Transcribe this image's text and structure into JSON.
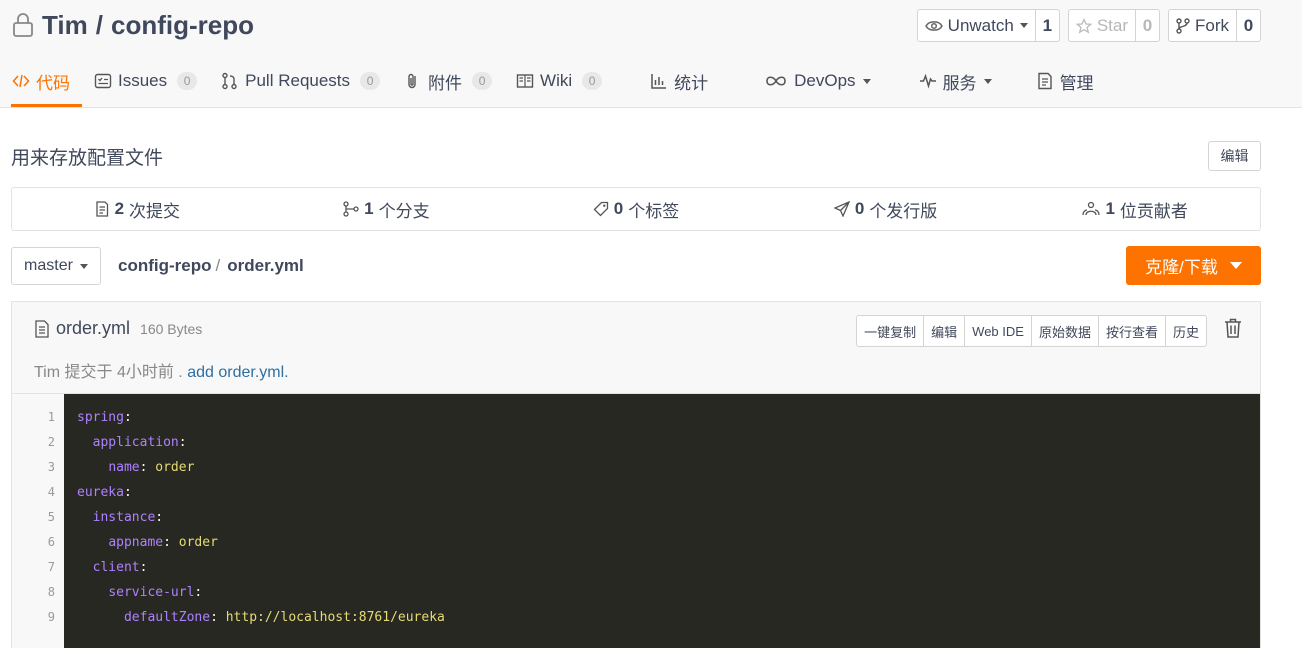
{
  "repo": {
    "owner": "Tim",
    "separator": "/",
    "name": "config-repo"
  },
  "actions": {
    "watch": {
      "label": "Unwatch",
      "count": "1"
    },
    "star": {
      "label": "Star",
      "count": "0"
    },
    "fork": {
      "label": "Fork",
      "count": "0"
    }
  },
  "tabs": [
    {
      "label": "代码",
      "icon": "code-icon",
      "active": true
    },
    {
      "label": "Issues",
      "icon": "issues-icon",
      "badge": "0"
    },
    {
      "label": "Pull Requests",
      "icon": "pull-request-icon",
      "badge": "0"
    },
    {
      "label": "附件",
      "icon": "paperclip-icon",
      "badge": "0"
    },
    {
      "label": "Wiki",
      "icon": "book-icon",
      "badge": "0"
    },
    {
      "label": "统计",
      "icon": "bar-chart-icon"
    },
    {
      "label": "DevOps",
      "icon": "infinity-icon",
      "dropdown": true
    },
    {
      "label": "服务",
      "icon": "pulse-icon",
      "dropdown": true
    },
    {
      "label": "管理",
      "icon": "manage-icon"
    }
  ],
  "description": "用来存放配置文件",
  "edit_label": "编辑",
  "stats": [
    {
      "count": "2",
      "label": "次提交",
      "icon": "commit-icon"
    },
    {
      "count": "1",
      "label": "个分支",
      "icon": "branch-icon"
    },
    {
      "count": "0",
      "label": "个标签",
      "icon": "tag-icon"
    },
    {
      "count": "0",
      "label": "个发行版",
      "icon": "release-icon"
    },
    {
      "count": "1",
      "label": "位贡献者",
      "icon": "contributors-icon"
    }
  ],
  "branch": "master",
  "breadcrumb": {
    "repo": "config-repo",
    "slash": "/",
    "file": "order.yml"
  },
  "clone_label": "克隆/下载",
  "file": {
    "name": "order.yml",
    "size": "160 Bytes",
    "commit_author": "Tim",
    "commit_text": "提交于 4小时前 .",
    "commit_message": "add order.yml.",
    "buttons": [
      "一键复制",
      "编辑",
      "Web IDE",
      "原始数据",
      "按行查看",
      "历史"
    ]
  },
  "code": {
    "line_numbers": [
      "1",
      "2",
      "3",
      "4",
      "5",
      "6",
      "7",
      "8",
      "9"
    ],
    "lines": [
      {
        "indent": "",
        "key": "spring",
        "value": ""
      },
      {
        "indent": "  ",
        "key": "application",
        "value": ""
      },
      {
        "indent": "    ",
        "key": "name",
        "value": "order"
      },
      {
        "indent": "",
        "key": "eureka",
        "value": ""
      },
      {
        "indent": "  ",
        "key": "instance",
        "value": ""
      },
      {
        "indent": "    ",
        "key": "appname",
        "value": "order"
      },
      {
        "indent": "  ",
        "key": "client",
        "value": ""
      },
      {
        "indent": "    ",
        "key": "service-url",
        "value": ""
      },
      {
        "indent": "      ",
        "key": "defaultZone",
        "value": "http://localhost:8761/eureka"
      }
    ],
    "colors": {
      "background": "#272822",
      "key": "#ae81ff",
      "value": "#e6db74"
    }
  },
  "colors": {
    "accent": "#fe7300",
    "text": "#40485b",
    "link": "#2f6f9f"
  }
}
